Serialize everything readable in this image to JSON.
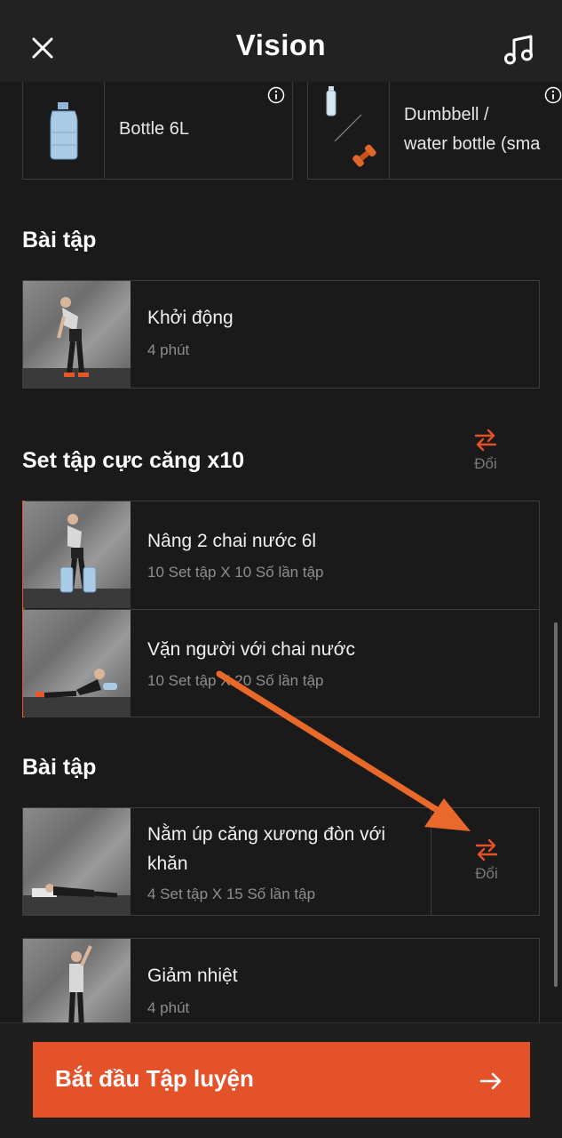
{
  "header": {
    "title": "Vision",
    "close_icon": "close-icon",
    "music_icon": "music-icon"
  },
  "equipment": [
    {
      "label": "Bottle 6L",
      "icon": "water-jug-icon"
    },
    {
      "label_line1": "Dumbbell /",
      "label_line2": "water bottle (sma",
      "icon": "dumbbell-bottle-icon"
    }
  ],
  "sections": {
    "warmup_title": "Bài tập",
    "superset_title": "Set tập cực căng x10",
    "exercises_title": "Bài tập"
  },
  "warmup": {
    "name": "Khởi động",
    "detail": "4 phút"
  },
  "superset": [
    {
      "name": "Nâng 2 chai nước 6l",
      "detail": "10 Set tập X 10 Số lần tập"
    },
    {
      "name": "Vặn người với chai nước",
      "detail": "10 Set tập X 20 Số lần tập"
    }
  ],
  "exercises": [
    {
      "name_line1": "Nằm úp căng xương đòn với",
      "name_line2": "khăn",
      "detail": "4 Set tập X 15 Số lần tập"
    },
    {
      "name": "Giảm nhiệt",
      "detail": "4 phút"
    }
  ],
  "swap_label": "Đổi",
  "footer": {
    "start_label": "Bắt đầu Tập luyện"
  },
  "colors": {
    "accent": "#e4522a",
    "background": "#1a1a1a",
    "border": "#3d3d3d"
  }
}
